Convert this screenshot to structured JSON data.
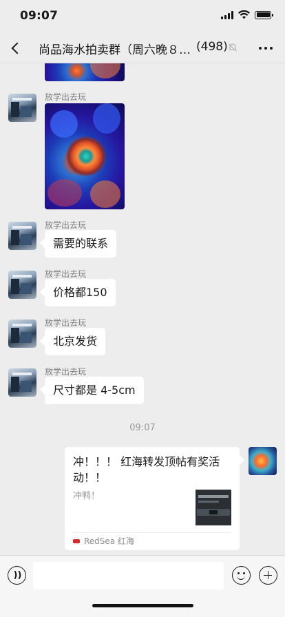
{
  "status_bar": {
    "time": "09:07"
  },
  "header": {
    "title": "尚品海水拍卖群（周六晚８…",
    "member_count": "(498)"
  },
  "messages": [
    {
      "sender": "放学出去玩",
      "type": "image"
    },
    {
      "sender": "放学出去玩",
      "type": "text",
      "text": "需要的联系"
    },
    {
      "sender": "放学出去玩",
      "type": "text",
      "text": "价格都150"
    },
    {
      "sender": "放学出去玩",
      "type": "text",
      "text": "北京发货"
    },
    {
      "sender": "放学出去玩",
      "type": "text",
      "text": "尺寸都是 4-5cm"
    }
  ],
  "timestamp": "09:07",
  "my_link_card": {
    "title": "冲！！！ 红海转发顶帖有奖活动！！",
    "description": "冲鸭！",
    "source": "RedSea 红海"
  },
  "input_bar": {
    "placeholder": ""
  }
}
